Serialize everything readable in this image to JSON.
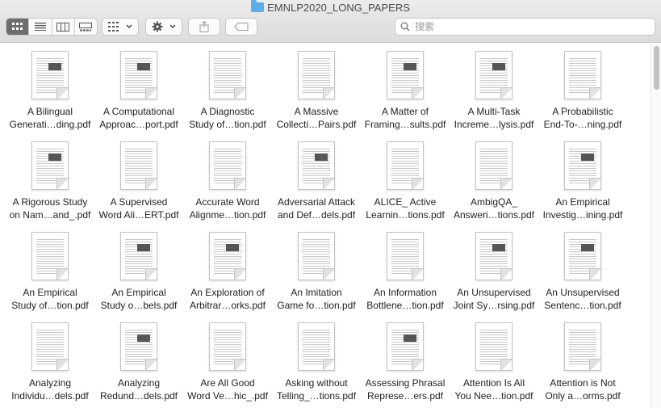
{
  "window": {
    "title": "EMNLP2020_LONG_PAPERS"
  },
  "toolbar": {
    "view_modes": [
      "icon-view",
      "list-view",
      "column-view",
      "gallery-view"
    ],
    "selected_view": "icon-view",
    "group_button": "group-by",
    "action_button": "action-menu",
    "share_button": "share",
    "tag_button": "tags"
  },
  "search": {
    "placeholder": "搜索"
  },
  "files": [
    {
      "line1": "A Bilingual",
      "line2": "Generati…ding.pdf"
    },
    {
      "line1": "A Computational",
      "line2": "Approac…port.pdf"
    },
    {
      "line1": "A Diagnostic",
      "line2": "Study of…tion.pdf"
    },
    {
      "line1": "A Massive",
      "line2": "Collecti…Pairs.pdf"
    },
    {
      "line1": "A Matter of",
      "line2": "Framing…sults.pdf"
    },
    {
      "line1": "A Multi-Task",
      "line2": "Increme…lysis.pdf"
    },
    {
      "line1": "A Probabilistic",
      "line2": "End-To-…ning.pdf"
    },
    {
      "line1": "A Rigorous Study",
      "line2": "on Nam…and_.pdf"
    },
    {
      "line1": "A Supervised",
      "line2": "Word Ali…ERT.pdf"
    },
    {
      "line1": "Accurate Word",
      "line2": "Alignme…tion.pdf"
    },
    {
      "line1": "Adversarial Attack",
      "line2": "and Def…dels.pdf"
    },
    {
      "line1": "ALICE_ Active",
      "line2": "Learnin…tions.pdf"
    },
    {
      "line1": "AmbigQA_",
      "line2": "Answeri…tions.pdf"
    },
    {
      "line1": "An Empirical",
      "line2": "Investig…ining.pdf"
    },
    {
      "line1": "An Empirical",
      "line2": "Study of…tion.pdf"
    },
    {
      "line1": "An Empirical",
      "line2": "Study o…bels.pdf"
    },
    {
      "line1": "An Exploration of",
      "line2": "Arbitrar…orks.pdf"
    },
    {
      "line1": "An Imitation",
      "line2": "Game fo…tion.pdf"
    },
    {
      "line1": "An Information",
      "line2": "Bottlene…tion.pdf"
    },
    {
      "line1": "An Unsupervised",
      "line2": "Joint Sy…rsing.pdf"
    },
    {
      "line1": "An Unsupervised",
      "line2": "Sentenc…tion.pdf"
    },
    {
      "line1": "Analyzing",
      "line2": "Individu…dels.pdf"
    },
    {
      "line1": "Analyzing",
      "line2": "Redund…dels.pdf"
    },
    {
      "line1": "Are All Good",
      "line2": "Word Ve…hic_.pdf"
    },
    {
      "line1": "Asking without",
      "line2": "Telling_…tions.pdf"
    },
    {
      "line1": "Assessing Phrasal",
      "line2": "Represe…ers.pdf"
    },
    {
      "line1": "Attention Is All",
      "line2": "You Nee…tion.pdf"
    },
    {
      "line1": "Attention is Not",
      "line2": "Only a…orms.pdf"
    }
  ]
}
